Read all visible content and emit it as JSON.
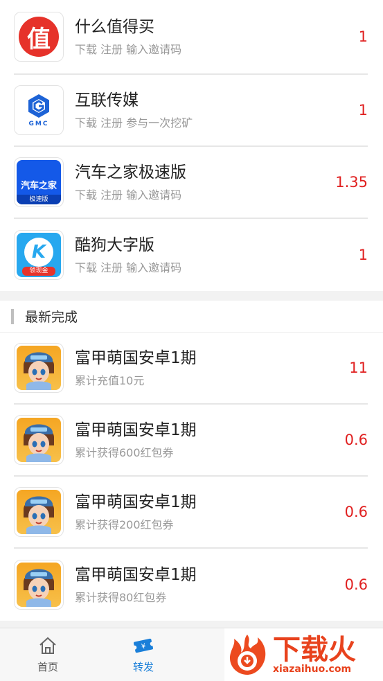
{
  "tasks": [
    {
      "icon": "zhi-icon",
      "title": "什么值得买",
      "sub": "下载 注册 输入邀请码",
      "reward": "1",
      "icon_text": "值"
    },
    {
      "icon": "gmc-icon",
      "title": "互联传媒",
      "sub": "下载 注册 参与一次挖矿",
      "reward": "1",
      "icon_text": "GMC"
    },
    {
      "icon": "autohome-icon",
      "title": "汽车之家极速版",
      "sub": "下载 注册 输入邀请码",
      "reward": "1.35",
      "icon_text": "汽车之家",
      "icon_badge": "极速版"
    },
    {
      "icon": "kugou-icon",
      "title": "酷狗大字版",
      "sub": "下载 注册 输入邀请码",
      "reward": "1",
      "icon_text": "K",
      "icon_badge": "领现金"
    }
  ],
  "latest": {
    "header": "最新完成",
    "items": [
      {
        "title": "富甲萌国安卓1期",
        "sub": "累计充值10元",
        "reward": "11"
      },
      {
        "title": "富甲萌国安卓1期",
        "sub": "累计获得600红包券",
        "reward": "0.6"
      },
      {
        "title": "富甲萌国安卓1期",
        "sub": "累计获得200红包券",
        "reward": "0.6"
      },
      {
        "title": "富甲萌国安卓1期",
        "sub": "累计获得80红包券",
        "reward": "0.6"
      }
    ]
  },
  "tabbar": {
    "home_label": "首页",
    "forward_label": "转发"
  },
  "watermark": {
    "brand": "下载火",
    "domain": "xiazaihuo.com"
  },
  "colors": {
    "reward": "#e02020",
    "active_tab": "#1a7fd9",
    "watermark": "#e8421d"
  }
}
